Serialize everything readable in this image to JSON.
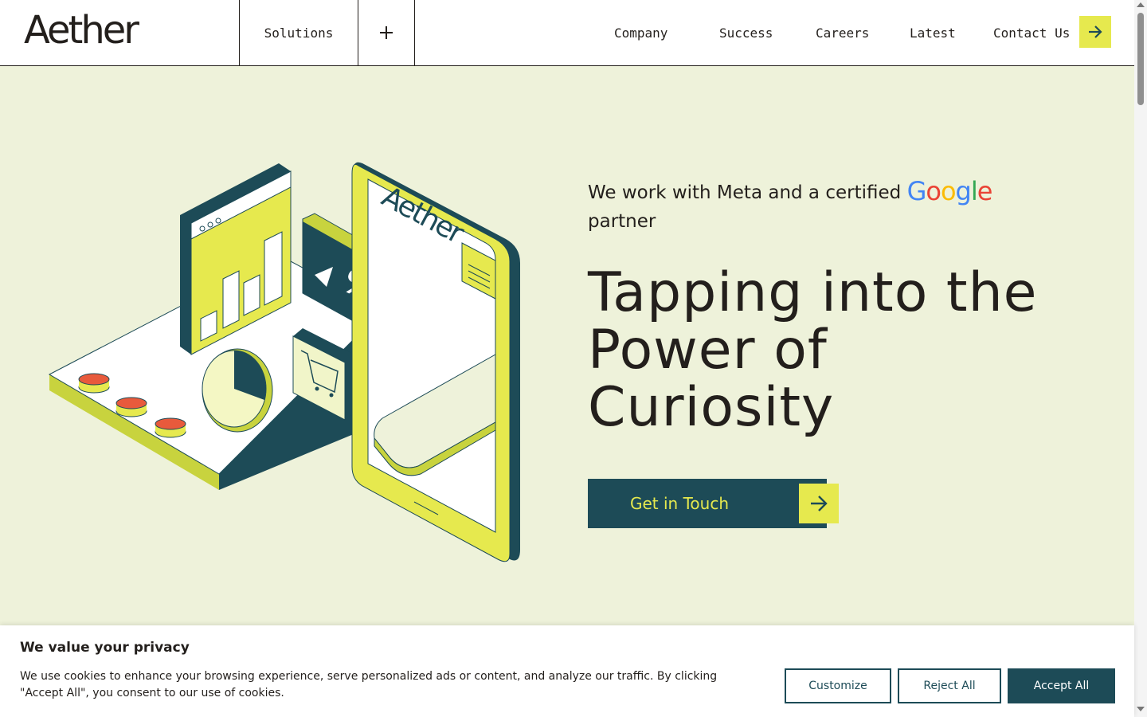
{
  "header": {
    "logo": "Aether",
    "solutions_label": "Solutions",
    "nav": [
      {
        "label": "Company"
      },
      {
        "label": "Success"
      },
      {
        "label": "Careers"
      },
      {
        "label": "Latest"
      },
      {
        "label": "Contact Us"
      }
    ],
    "plus_icon": "plus-icon",
    "cta_icon": "arrow-right-icon"
  },
  "hero": {
    "partner_prefix": "We work with Meta and a certified",
    "partner_brand": "Google",
    "partner_suffix": "partner",
    "title_lines": [
      "Tapping into the",
      "Power of",
      "Curiosity"
    ],
    "cta_label": "Get in Touch",
    "illustration_brand": "Aether",
    "illustration_badge": "%"
  },
  "cookie": {
    "title": "We value your privacy",
    "text": "We use cookies to enhance your browsing experience, serve personalized ads or content, and analyze our traffic. By clicking \"Accept All\", you consent to our use of cookies.",
    "customize": "Customize",
    "reject": "Reject All",
    "accept": "Accept All"
  },
  "colors": {
    "background": "#eef2da",
    "accent_yellow": "#e6e94e",
    "teal": "#1d4b57",
    "text": "#231f1c",
    "coral": "#e85a3c"
  }
}
